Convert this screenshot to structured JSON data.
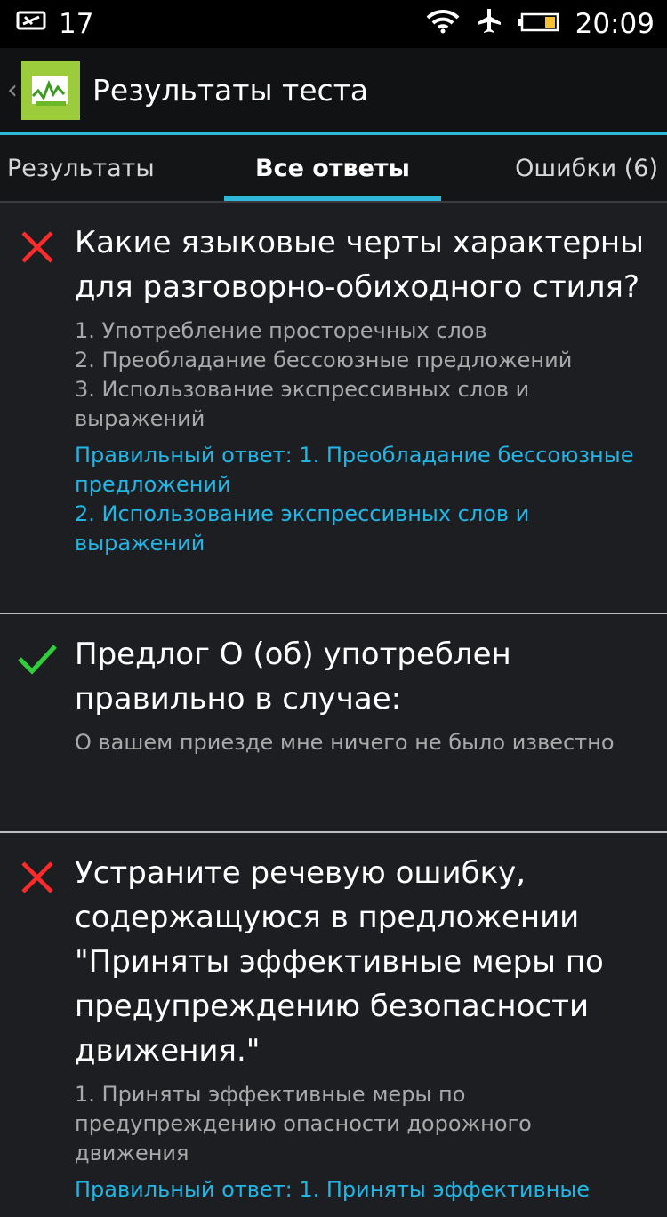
{
  "status": {
    "notification_count": "17",
    "time": "20:09"
  },
  "actionbar": {
    "title": "Результаты теста"
  },
  "tabs": [
    {
      "label": "Результаты"
    },
    {
      "label": "Все ответы"
    },
    {
      "label": "Ошибки (6)"
    }
  ],
  "items": [
    {
      "status": "wrong",
      "question": "Какие языковые черты характерны для разговорно-обиходного стиля?",
      "options": [
        "1. Употребление просторечных слов",
        "2. Преобладание бессоюзные предложений",
        "3. Использование экспрессивных слов и выражений"
      ],
      "answer": [
        "Правильный ответ: 1. Преобладание бессоюзные предложений",
        "2. Использование экспрессивных слов и выражений"
      ]
    },
    {
      "status": "correct",
      "question": "Предлог О (об) употреблен правильно в случае:",
      "options": [
        "О вашем приезде мне ничего не было известно"
      ]
    },
    {
      "status": "wrong",
      "question": "Устраните речевую ошибку, содержащуюся в предложении \"Приняты эффективные меры по предупреждению безопасности движения.\"",
      "options": [
        "1. Приняты эффективные меры по предупреждению опасности дорожного движения"
      ],
      "answer": [
        "Правильный ответ: 1. Приняты эффективные"
      ]
    }
  ],
  "colors": {
    "accent": "#2fb6d8",
    "correct": "#2ecf38",
    "wrong": "#ff2a2a",
    "answer_text": "#22b6e6"
  }
}
